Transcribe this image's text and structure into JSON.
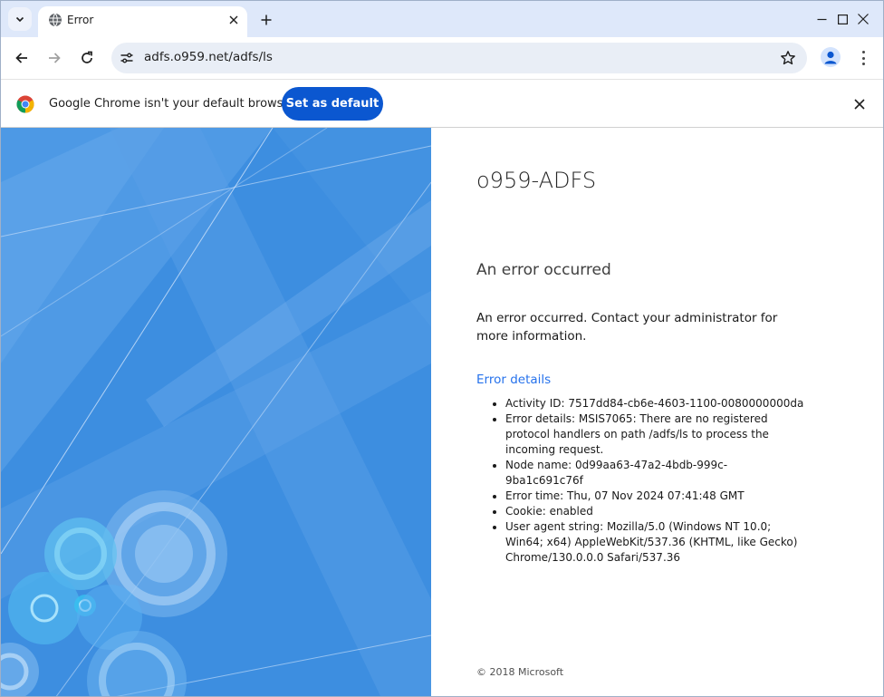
{
  "browser": {
    "tab_title": "Error",
    "url": "adfs.o959.net/adfs/ls",
    "infobar_text": "Google Chrome isn't your default browser",
    "set_default_label": "Set as default"
  },
  "page": {
    "company_name": "o959-ADFS",
    "heading": "An error occurred",
    "message": "An error occurred. Contact your administrator for more information.",
    "details_link": "Error details",
    "details": [
      "Activity ID: 7517dd84-cb6e-4603-1100-0080000000da",
      "Error details: MSIS7065: There are no registered protocol handlers on path /adfs/ls to process the incoming request.",
      "Node name: 0d99aa63-47a2-4bdb-999c-9ba1c691c76f",
      "Error time: Thu, 07 Nov 2024 07:41:48 GMT",
      "Cookie: enabled",
      "User agent string: Mozilla/5.0 (Windows NT 10.0; Win64; x64) AppleWebKit/537.36 (KHTML, like Gecko) Chrome/130.0.0.0 Safari/537.36"
    ],
    "copyright": "© 2018 Microsoft"
  },
  "icons": {
    "tab_search": "chevron-down-icon",
    "favicon": "globe-icon",
    "tab_close": "close-icon",
    "new_tab": "plus-icon",
    "minimize": "minimize-icon",
    "maximize": "maximize-icon",
    "close_window": "close-icon",
    "back": "back-arrow-icon",
    "forward": "forward-arrow-icon",
    "reload": "reload-icon",
    "site_info": "tune-icon",
    "bookmark": "star-icon",
    "profile": "avatar-icon",
    "menu": "more-vert-icon",
    "chrome": "chrome-logo-icon"
  },
  "colors": {
    "tabstrip": "#dee8fa",
    "omnibox": "#e9eef6",
    "primary_button": "#0b57d0",
    "illustration_blue": "#3d8ee0",
    "link": "#2672ec"
  }
}
